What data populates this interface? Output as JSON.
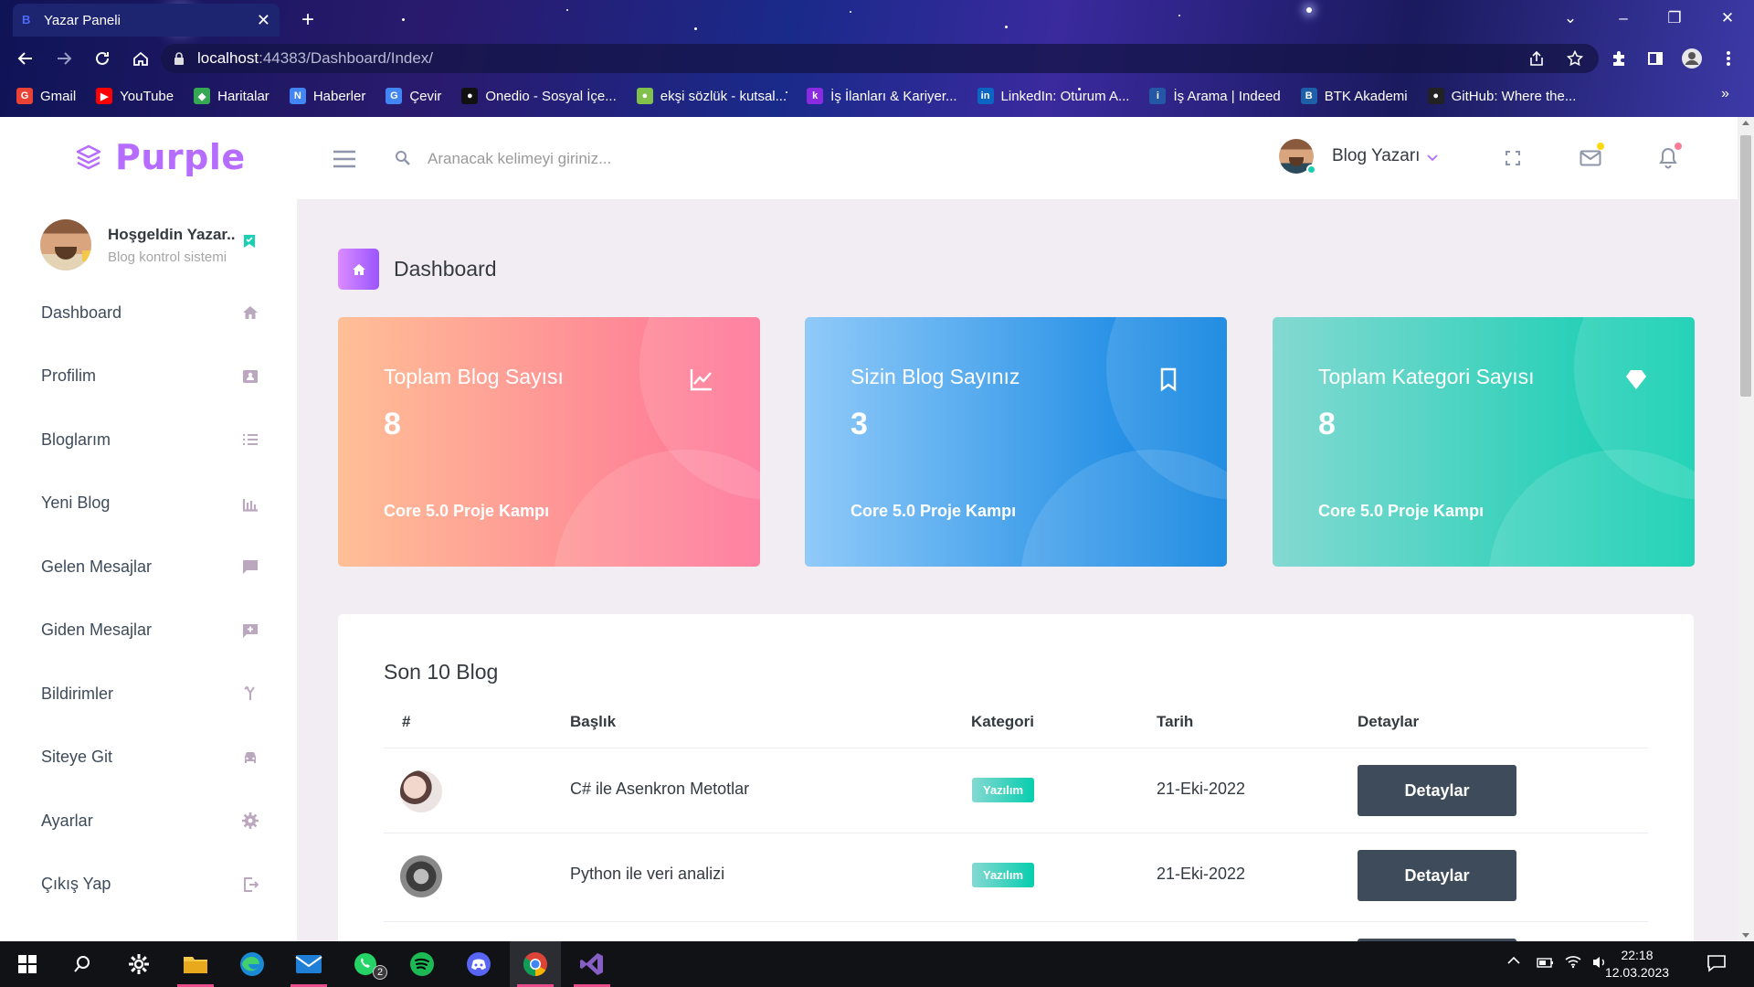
{
  "browser": {
    "tab_title": "Yazar Paneli",
    "url_host": "localhost",
    "url_path": ":44383/Dashboard/Index/",
    "bookmarks": [
      {
        "label": "Gmail",
        "icon": "gmail-icon",
        "color": "#ea4335"
      },
      {
        "label": "YouTube",
        "icon": "youtube-icon",
        "color": "#ff0000"
      },
      {
        "label": "Haritalar",
        "icon": "maps-icon",
        "color": "#34a853"
      },
      {
        "label": "Haberler",
        "icon": "news-icon",
        "color": "#4285f4"
      },
      {
        "label": "Çevir",
        "icon": "translate-icon",
        "color": "#4285f4"
      },
      {
        "label": "Onedio - Sosyal İçe...",
        "icon": "onedio-icon",
        "color": "#111111"
      },
      {
        "label": "ekşi sözlük - kutsal...",
        "icon": "eksi-icon",
        "color": "#81c14b"
      },
      {
        "label": "İş İlanları & Kariyer...",
        "icon": "kariyer-icon",
        "color": "#8a2be2"
      },
      {
        "label": "LinkedIn: Oturum A...",
        "icon": "linkedin-icon",
        "color": "#0a66c2"
      },
      {
        "label": "İş Arama | Indeed",
        "icon": "indeed-icon",
        "color": "#2557a7"
      },
      {
        "label": "BTK Akademi",
        "icon": "btk-icon",
        "color": "#1d5fa8"
      },
      {
        "label": "GitHub: Where the...",
        "icon": "github-icon",
        "color": "#222222"
      }
    ]
  },
  "app": {
    "logo": "Purple",
    "search_placeholder": "Aranacak kelimeyi giriniz...",
    "header_user": "Blog Yazarı"
  },
  "sidebar": {
    "welcome": "Hoşgeldin Yazar..",
    "subtitle": "Blog kontrol sistemi",
    "items": [
      {
        "label": "Dashboard",
        "icon": "home-icon"
      },
      {
        "label": "Profilim",
        "icon": "contact-card-icon"
      },
      {
        "label": "Bloglarım",
        "icon": "list-icon"
      },
      {
        "label": "Yeni Blog",
        "icon": "bar-chart-icon"
      },
      {
        "label": "Gelen Mesajlar",
        "icon": "message-icon"
      },
      {
        "label": "Giden Mesajlar",
        "icon": "message-plus-icon"
      },
      {
        "label": "Bildirimler",
        "icon": "merge-icon"
      },
      {
        "label": "Siteye Git",
        "icon": "car-icon"
      },
      {
        "label": "Ayarlar",
        "icon": "settings-icon"
      },
      {
        "label": "Çıkış Yap",
        "icon": "logout-icon"
      }
    ]
  },
  "page": {
    "title": "Dashboard"
  },
  "cards": [
    {
      "title": "Toplam Blog Sayısı",
      "value": "8",
      "subtitle": "Core 5.0 Proje Kampı",
      "icon": "chart-line-icon",
      "color_from": "#ffbf96",
      "color_to": "#fe7096"
    },
    {
      "title": "Sizin Blog Sayınız",
      "value": "3",
      "subtitle": "Core 5.0 Proje Kampı",
      "icon": "bookmark-icon",
      "color_from": "#90caf9",
      "color_to": "#047edf"
    },
    {
      "title": "Toplam Kategori Sayısı",
      "value": "8",
      "subtitle": "Core 5.0 Proje Kampı",
      "icon": "diamond-icon",
      "color_from": "#84d9d2",
      "color_to": "#07cdae"
    }
  ],
  "table": {
    "title": "Son 10 Blog",
    "headers": [
      "#",
      "Başlık",
      "Kategori",
      "Tarih",
      "Detaylar"
    ],
    "rows": [
      {
        "title": "C# ile Asenkron Metotlar",
        "category": "Yazılım",
        "date": "21-Eki-2022",
        "button": "Detaylar"
      },
      {
        "title": "Python ile veri analizi",
        "category": "Yazılım",
        "date": "21-Eki-2022",
        "button": "Detaylar"
      }
    ]
  },
  "taskbar": {
    "time": "22:18",
    "date": "12.03.2023",
    "whatsapp_badge": "2"
  }
}
